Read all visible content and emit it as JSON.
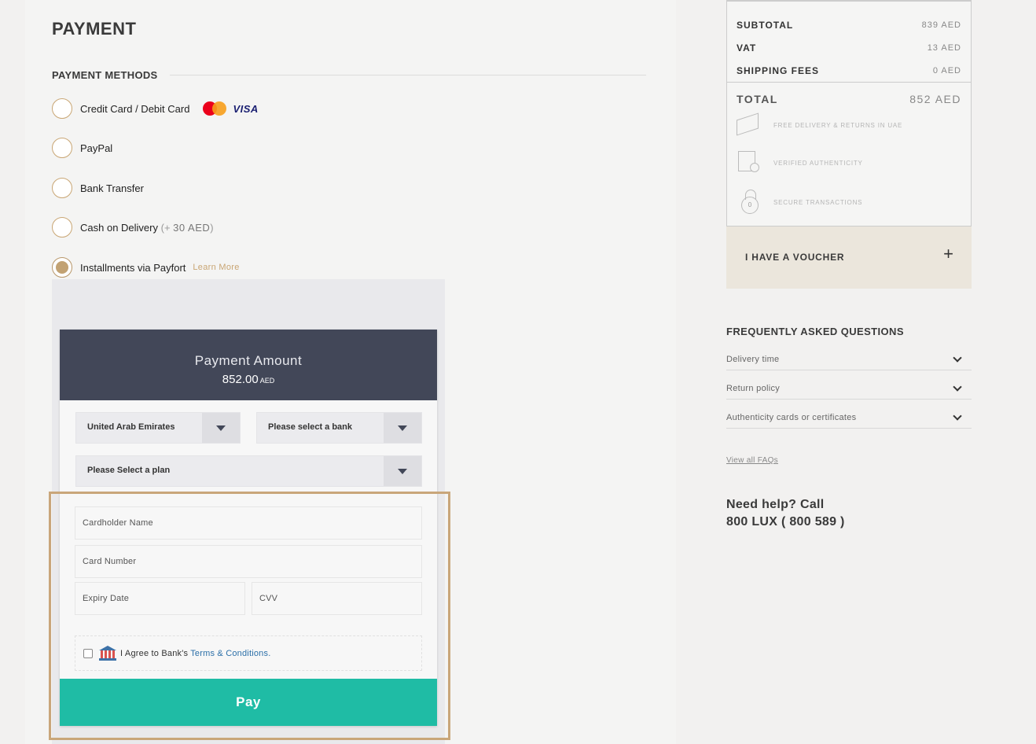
{
  "payment": {
    "title": "PAYMENT",
    "methods_heading": "PAYMENT METHODS",
    "methods": [
      {
        "label": "Credit Card / Debit Card",
        "icons": [
          "mastercard-icon",
          "visa-icon"
        ],
        "visa_text": "VISA"
      },
      {
        "label": "PayPal"
      },
      {
        "label": "Bank Transfer"
      },
      {
        "label": "Cash on Delivery",
        "extra_open": "(+",
        "extra_amount": "30 AED",
        "extra_close": ")"
      },
      {
        "label": "Installments via Payfort",
        "link": "Learn More",
        "selected": true
      }
    ]
  },
  "payfort": {
    "header_title": "Payment Amount",
    "amount": "852.00",
    "currency": "AED",
    "country_select": "United Arab Emirates",
    "bank_select": "Please select a bank",
    "plan_select": "Please Select a plan",
    "cardholder_placeholder": "Cardholder Name",
    "card_number_placeholder": "Card Number",
    "expiry_placeholder": "Expiry Date",
    "cvv_placeholder": "CVV",
    "agree_text": "I Agree to Bank's",
    "agree_link": "Terms & Conditions.",
    "pay_label": "Pay"
  },
  "summary": {
    "subtotal_label": "SUBTOTAL",
    "subtotal_value": "839 AED",
    "vat_label": "VAT",
    "vat_value": "13 AED",
    "shipping_label": "SHIPPING FEES",
    "shipping_value": "0 AED",
    "total_label": "TOTAL",
    "total_value": "852 AED",
    "perks": [
      {
        "text": "FREE DELIVERY & RETURNS IN UAE",
        "icon": "box-icon"
      },
      {
        "text": "VERIFIED AUTHENTICITY",
        "icon": "certificate-icon"
      },
      {
        "text": "SECURE TRANSACTIONS",
        "icon": "lock-icon",
        "icon_text": "0"
      }
    ]
  },
  "voucher": {
    "label": "I HAVE A VOUCHER",
    "plus": "+"
  },
  "faq": {
    "heading": "FREQUENTLY ASKED QUESTIONS",
    "items": [
      "Delivery time",
      "Return policy",
      "Authenticity cards or certificates"
    ],
    "view_all": "View all FAQs"
  },
  "help": {
    "line1": "Need help? Call",
    "line2": "800 LUX ( 800 589 )"
  },
  "colors": {
    "accent_gold": "#c9a674",
    "pay_button": "#1fbca5",
    "header_dark": "#424758"
  }
}
